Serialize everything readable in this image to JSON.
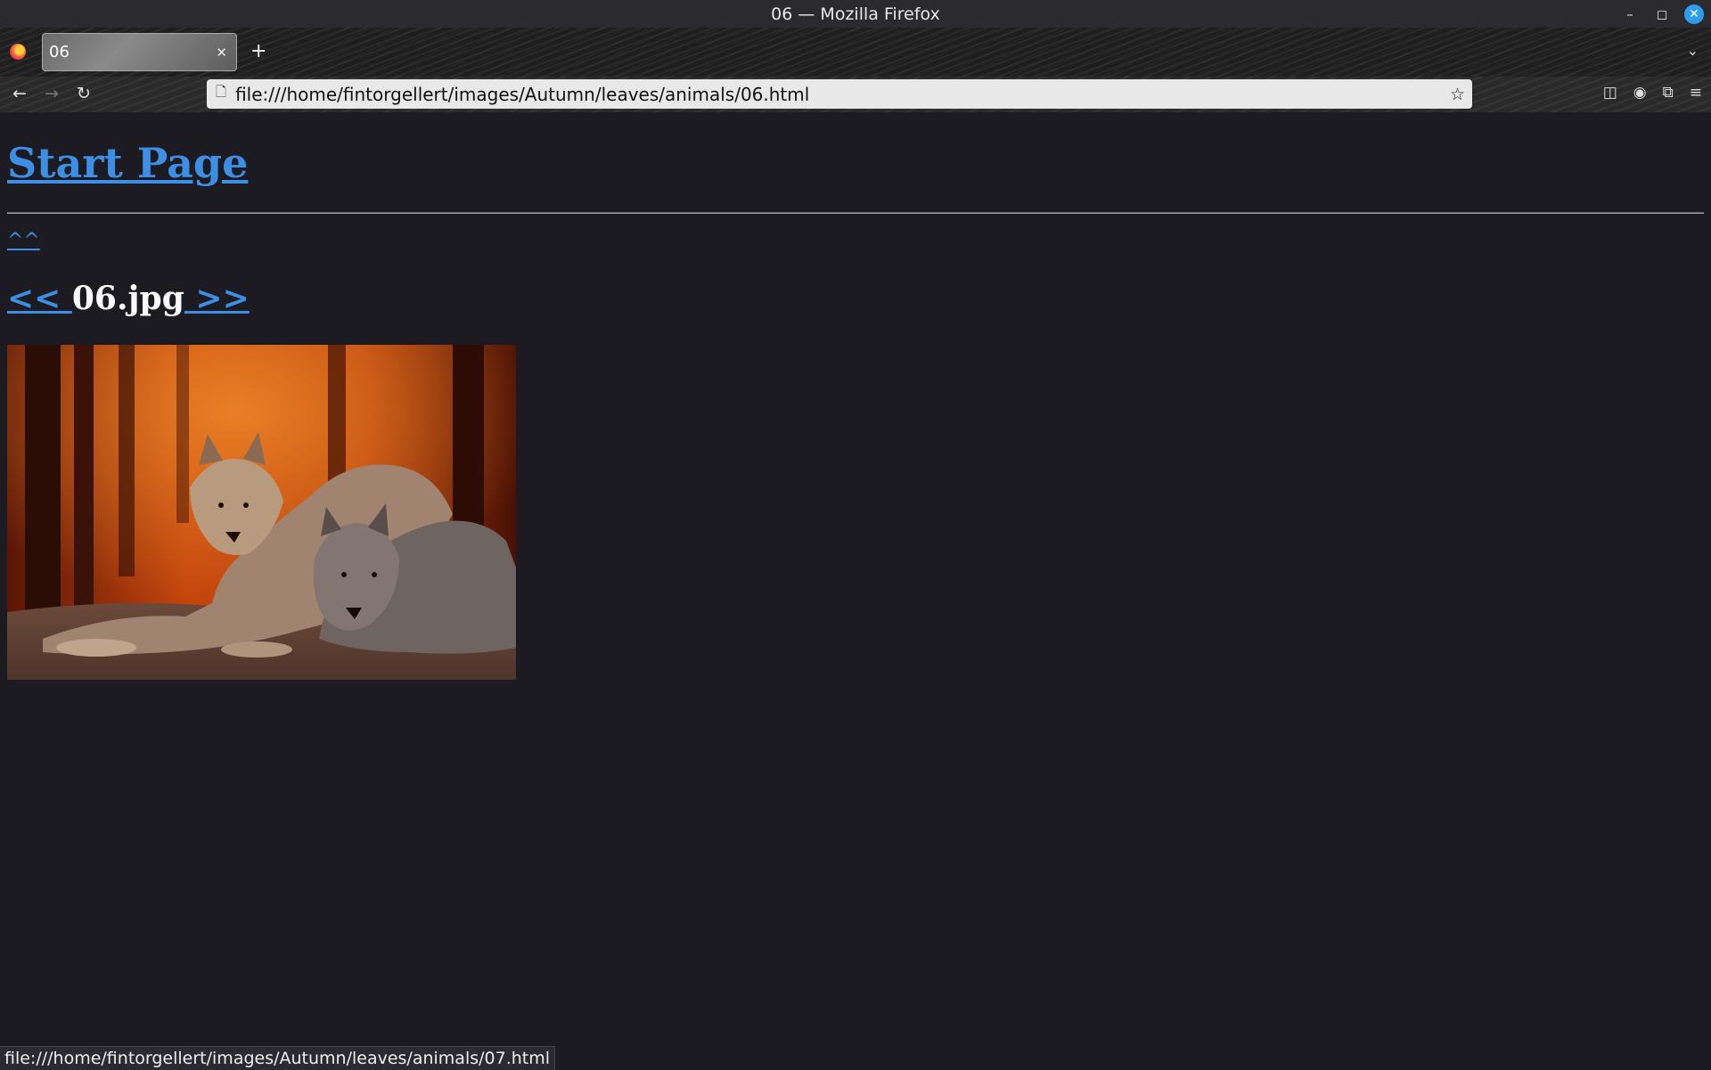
{
  "window": {
    "title": "06 — Mozilla Firefox"
  },
  "tabs": [
    {
      "label": "06",
      "active": true
    }
  ],
  "navbar": {
    "url": "file:///home/fintorgellert/images/Autumn/leaves/animals/06.html"
  },
  "page": {
    "heading_link": "Start Page",
    "up_link": "^^",
    "prev_link": "<< ",
    "image_name": "06.jpg",
    "next_link": " >>",
    "image": {
      "description_icon": "photo-two-wolves-autumn-forest"
    },
    "link_color": "#3d8fe6",
    "background_color": "#1c1b22"
  },
  "status_bar": {
    "text": "file:///home/fintorgellert/images/Autumn/leaves/animals/07.html"
  }
}
